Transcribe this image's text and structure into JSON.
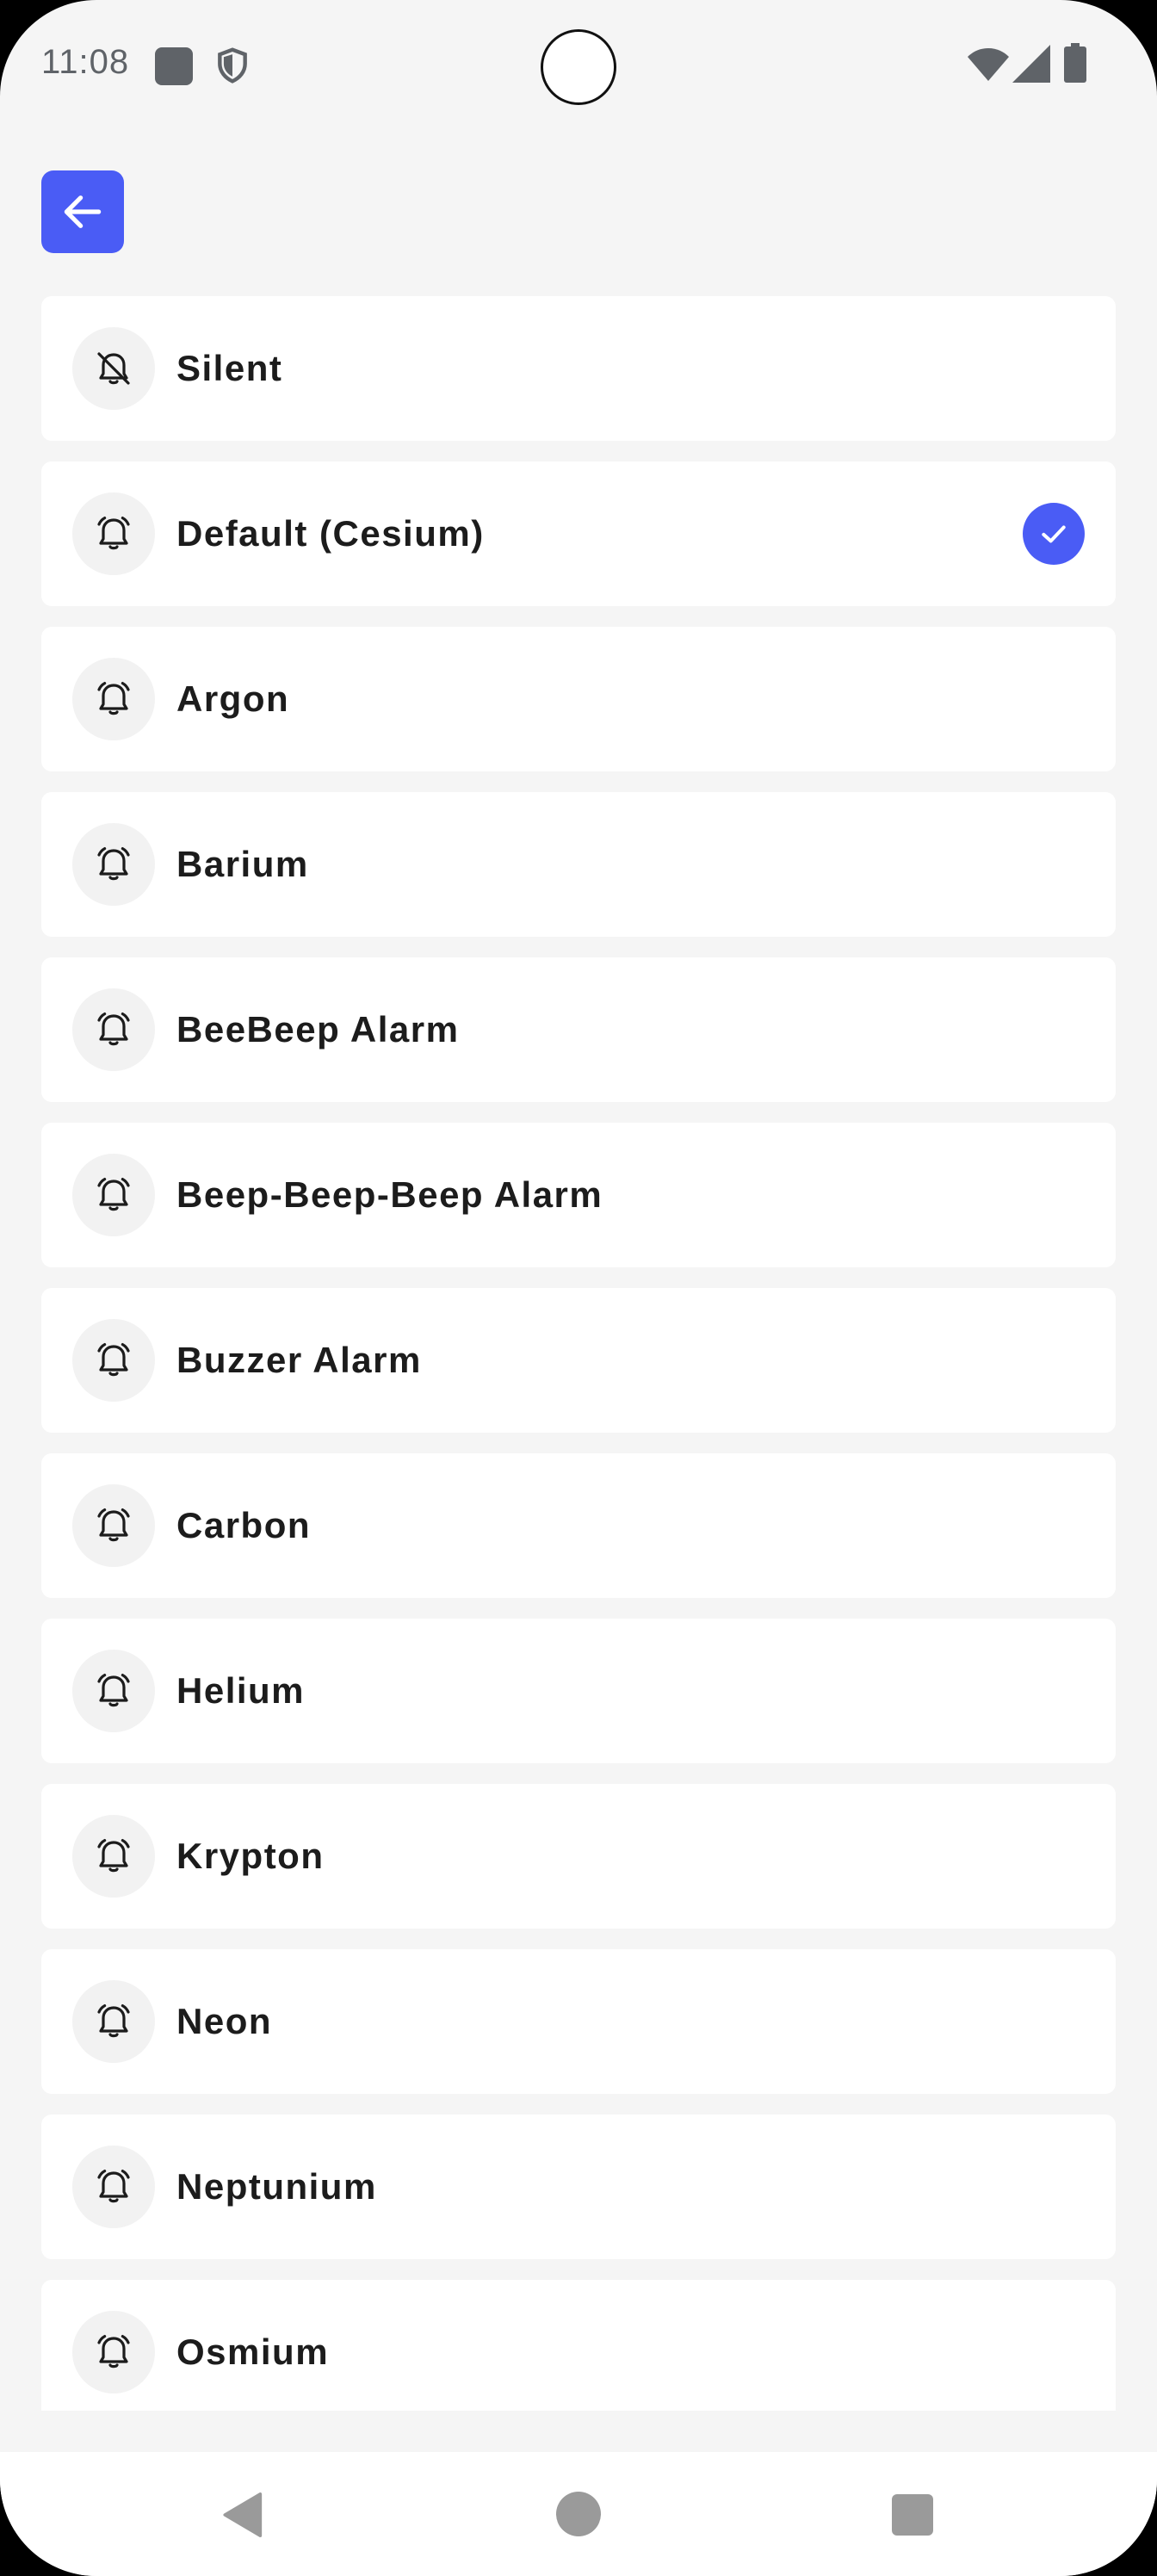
{
  "status_bar": {
    "time": "11:08",
    "icons": [
      "app-notification-icon",
      "shield-icon",
      "wifi-icon",
      "cell-signal-icon",
      "battery-icon"
    ]
  },
  "header": {
    "back_icon": "arrow-left-icon",
    "accent_color": "#4a5cf5"
  },
  "sounds": [
    {
      "label": "Silent",
      "icon": "bell-off-icon",
      "selected": false
    },
    {
      "label": "Default (Cesium)",
      "icon": "alarm-bell-icon",
      "selected": true
    },
    {
      "label": "Argon",
      "icon": "alarm-bell-icon",
      "selected": false
    },
    {
      "label": "Barium",
      "icon": "alarm-bell-icon",
      "selected": false
    },
    {
      "label": "BeeBeep Alarm",
      "icon": "alarm-bell-icon",
      "selected": false
    },
    {
      "label": "Beep-Beep-Beep Alarm",
      "icon": "alarm-bell-icon",
      "selected": false
    },
    {
      "label": "Buzzer Alarm",
      "icon": "alarm-bell-icon",
      "selected": false
    },
    {
      "label": "Carbon",
      "icon": "alarm-bell-icon",
      "selected": false
    },
    {
      "label": "Helium",
      "icon": "alarm-bell-icon",
      "selected": false
    },
    {
      "label": "Krypton",
      "icon": "alarm-bell-icon",
      "selected": false
    },
    {
      "label": "Neon",
      "icon": "alarm-bell-icon",
      "selected": false
    },
    {
      "label": "Neptunium",
      "icon": "alarm-bell-icon",
      "selected": false
    },
    {
      "label": "Osmium",
      "icon": "alarm-bell-icon",
      "selected": false
    }
  ],
  "nav_bar": {
    "icons": [
      "nav-back-icon",
      "nav-home-icon",
      "nav-recents-icon"
    ]
  }
}
